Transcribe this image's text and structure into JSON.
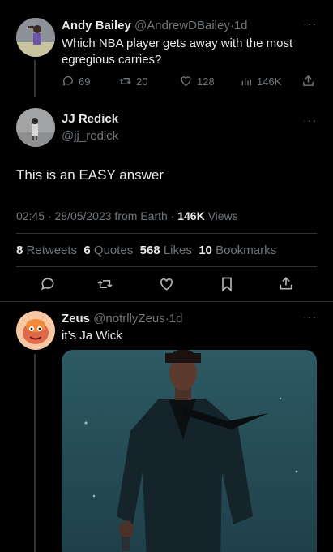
{
  "tweet1": {
    "name": "Andy Bailey",
    "handle": "@AndrewDBailey",
    "dot": "·",
    "time": "1d",
    "text": "Which NBA player gets away with the most egregious carries?",
    "replies": "69",
    "retweets": "20",
    "likes": "128",
    "views": "146K"
  },
  "main": {
    "name": "JJ Redick",
    "handle": "@jj_redick",
    "text": "This is an EASY answer",
    "meta_time": "02:45 · 28/05/2023 from Earth · ",
    "meta_views_count": "146K",
    "meta_views_label": " Views",
    "stats": [
      {
        "count": "8",
        "label": "Retweets"
      },
      {
        "count": "6",
        "label": "Quotes"
      },
      {
        "count": "568",
        "label": "Likes"
      },
      {
        "count": "10",
        "label": "Bookmarks"
      }
    ]
  },
  "reply": {
    "name": "Zeus",
    "handle": "@notrllyZeus",
    "dot": "·",
    "time": "1d",
    "text": "it’s Ja Wick"
  },
  "icons": {
    "more": "···"
  },
  "colors": {
    "background": "#000000",
    "text": "#e7e9ea",
    "muted": "#71767b",
    "divider": "#2f3336"
  }
}
